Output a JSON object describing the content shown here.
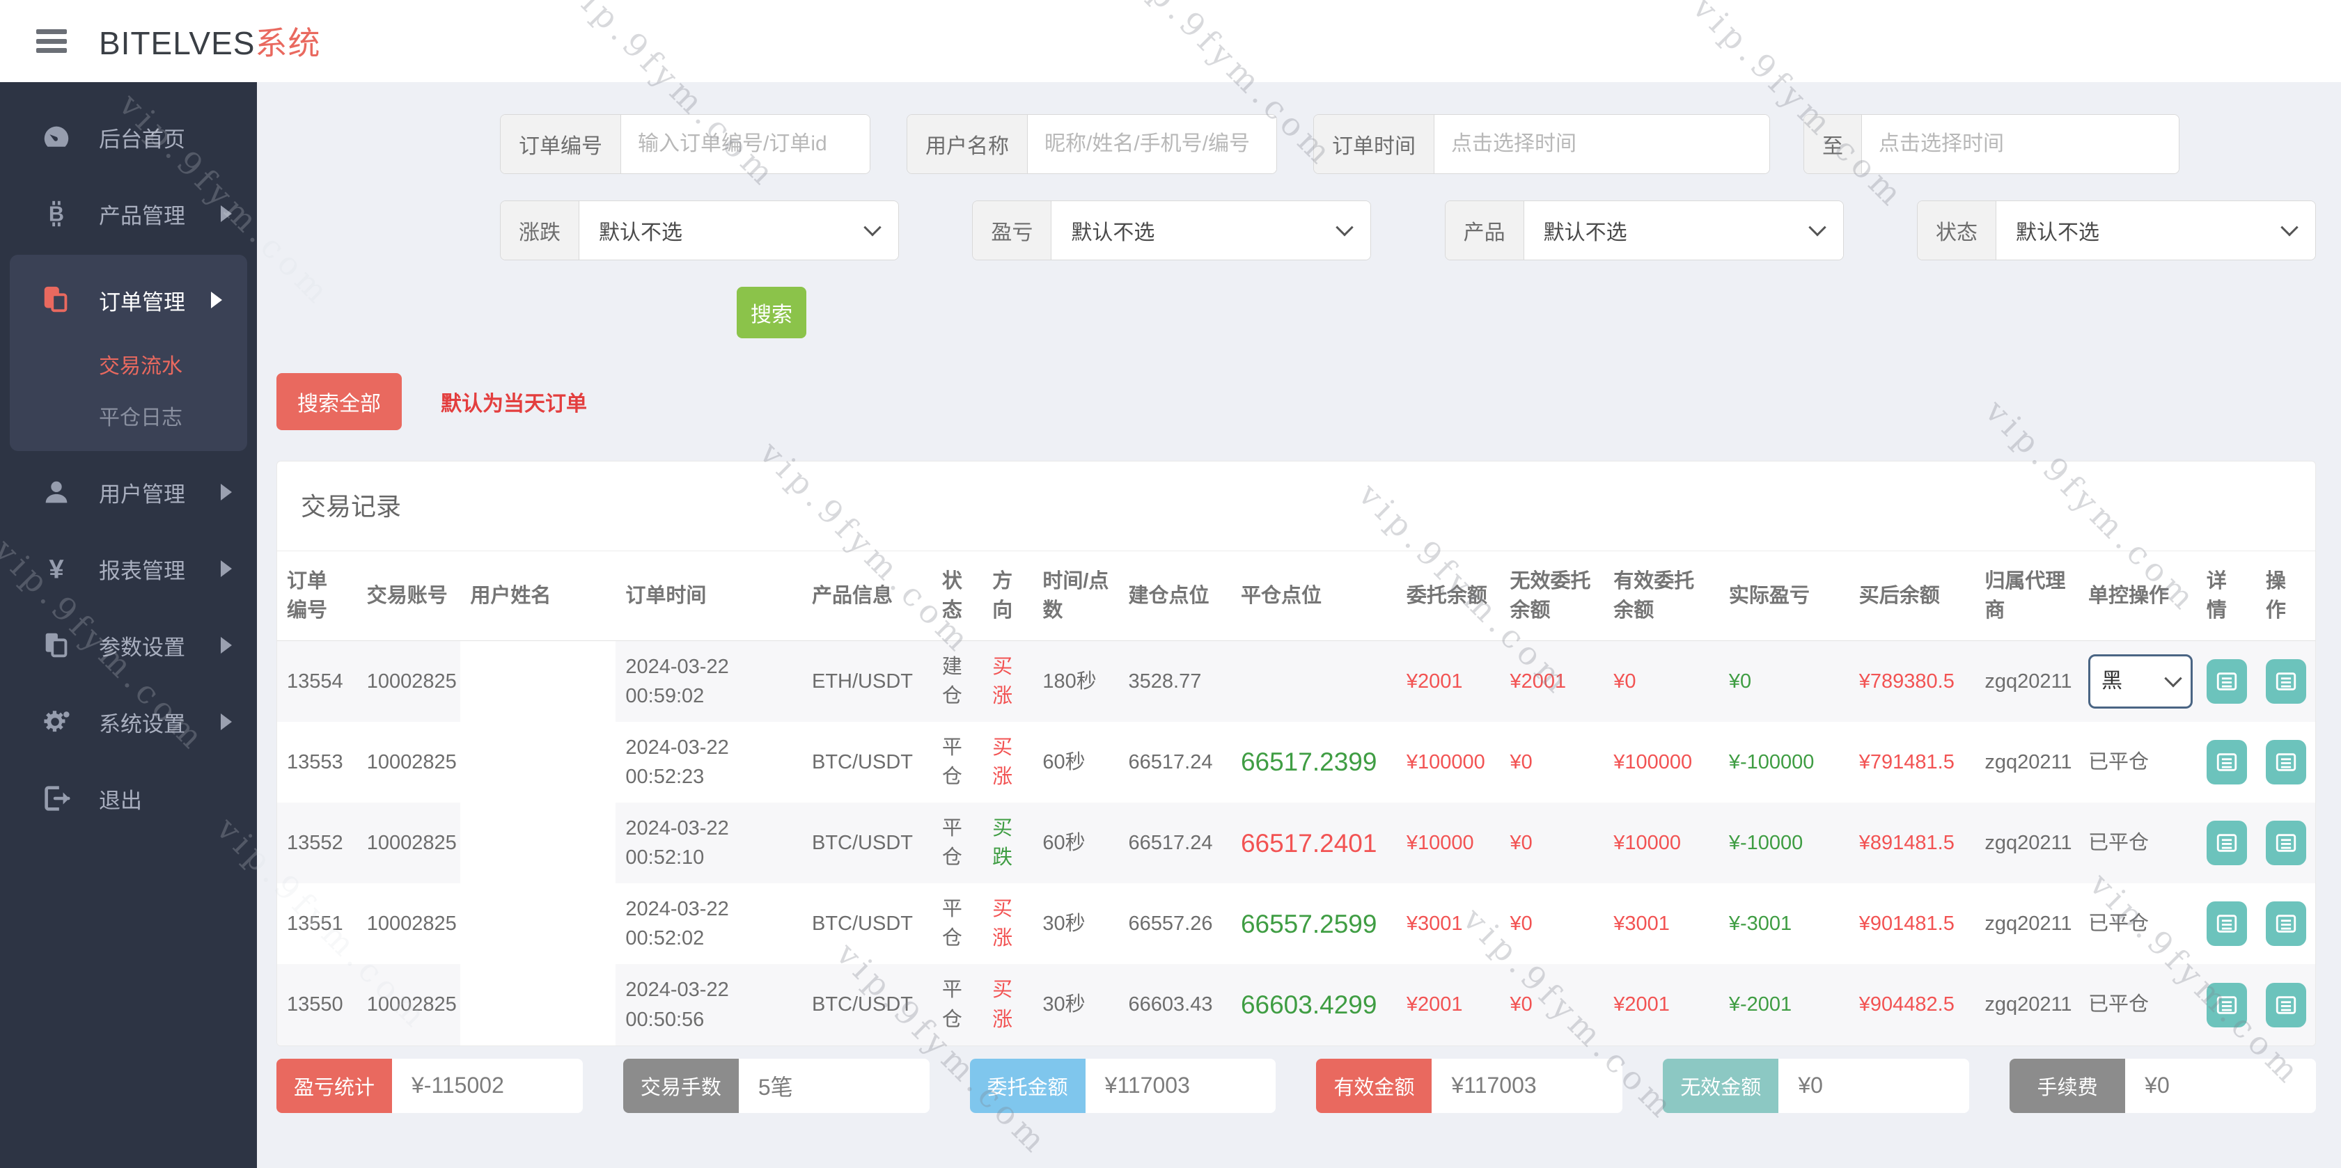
{
  "watermark": "vip.9fym.com",
  "header": {
    "brand": "BITELVES",
    "brand_suffix": "系统"
  },
  "sidebar": {
    "items": [
      {
        "label": "后台首页",
        "icon": "dashboard-icon"
      },
      {
        "label": "产品管理",
        "icon": "bitcoin-icon"
      },
      {
        "label": "订单管理",
        "icon": "orders-icon",
        "children": [
          {
            "label": "交易流水"
          },
          {
            "label": "平仓日志"
          }
        ]
      },
      {
        "label": "用户管理",
        "icon": "user-icon"
      },
      {
        "label": "报表管理",
        "icon": "yen-icon"
      },
      {
        "label": "参数设置",
        "icon": "params-icon"
      },
      {
        "label": "系统设置",
        "icon": "gear-icon"
      },
      {
        "label": "退出",
        "icon": "logout-icon"
      }
    ]
  },
  "filters": {
    "order_no_label": "订单编号",
    "order_no_placeholder": "输入订单编号/订单id",
    "user_label": "用户名称",
    "user_placeholder": "昵称/姓名/手机号/编号",
    "time_label": "订单时间",
    "time_placeholder": "点击选择时间",
    "to_label": "至",
    "time2_placeholder": "点击选择时间",
    "updown_label": "涨跌",
    "profit_label": "盈亏",
    "product_label": "产品",
    "status_label": "状态",
    "select_default": "默认不选",
    "search_btn": "搜索",
    "search_all_btn": "搜索全部",
    "hint": "默认为当天订单"
  },
  "table": {
    "title": "交易记录",
    "headers": [
      "订单编号",
      "交易账号",
      "用户姓名",
      "订单时间",
      "产品信息",
      "状态",
      "方向",
      "时间/点数",
      "建仓点位",
      "平仓点位",
      "委托余额",
      "无效委托余额",
      "有效委托余额",
      "实际盈亏",
      "买后余额",
      "归属代理商",
      "单控操作",
      "详情",
      "操作"
    ],
    "rows": [
      {
        "id": "13554",
        "account": "10002825",
        "name": "",
        "time": "2024-03-22 00:59:02",
        "product": "ETH/USDT",
        "status": "建仓",
        "dir": "买涨",
        "dur": "180秒",
        "open": "3528.77",
        "close": "",
        "entrust": "¥2001",
        "invalid": "¥2001",
        "valid": "¥0",
        "profit": "¥0",
        "after": "¥789380.5",
        "agent": "zgq20211",
        "control": "黑"
      },
      {
        "id": "13553",
        "account": "10002825",
        "name": "",
        "time": "2024-03-22 00:52:23",
        "product": "BTC/USDT",
        "status": "平仓",
        "dir": "买涨",
        "dur": "60秒",
        "open": "66517.24",
        "close": "66517.2399",
        "entrust": "¥100000",
        "invalid": "¥0",
        "valid": "¥100000",
        "profit": "¥-100000",
        "after": "¥791481.5",
        "agent": "zgq20211",
        "control": "已平仓"
      },
      {
        "id": "13552",
        "account": "10002825",
        "name": "",
        "time": "2024-03-22 00:52:10",
        "product": "BTC/USDT",
        "status": "平仓",
        "dir": "买跌",
        "dur": "60秒",
        "open": "66517.24",
        "close": "66517.2401",
        "entrust": "¥10000",
        "invalid": "¥0",
        "valid": "¥10000",
        "profit": "¥-10000",
        "after": "¥891481.5",
        "agent": "zgq20211",
        "control": "已平仓"
      },
      {
        "id": "13551",
        "account": "10002825",
        "name": "",
        "time": "2024-03-22 00:52:02",
        "product": "BTC/USDT",
        "status": "平仓",
        "dir": "买涨",
        "dur": "30秒",
        "open": "66557.26",
        "close": "66557.2599",
        "entrust": "¥3001",
        "invalid": "¥0",
        "valid": "¥3001",
        "profit": "¥-3001",
        "after": "¥901481.5",
        "agent": "zgq20211",
        "control": "已平仓"
      },
      {
        "id": "13550",
        "account": "10002825",
        "name": "",
        "time": "2024-03-22 00:50:56",
        "product": "BTC/USDT",
        "status": "平仓",
        "dir": "买涨",
        "dur": "30秒",
        "open": "66603.43",
        "close": "66603.4299",
        "entrust": "¥2001",
        "invalid": "¥0",
        "valid": "¥2001",
        "profit": "¥-2001",
        "after": "¥904482.5",
        "agent": "zgq20211",
        "control": "已平仓"
      }
    ]
  },
  "summary": {
    "items": [
      {
        "label": "盈亏统计",
        "value": "¥-115002",
        "color": "#e9695f"
      },
      {
        "label": "交易手数",
        "value": "5笔",
        "color": "#8c8c8c"
      },
      {
        "label": "委托金额",
        "value": "¥117003",
        "color": "#7fc6ed"
      },
      {
        "label": "有效金额",
        "value": "¥117003",
        "color": "#e9695f"
      },
      {
        "label": "无效金额",
        "value": "¥0",
        "color": "#8cc8c3"
      },
      {
        "label": "手续费",
        "value": "¥0",
        "color": "#8c8c8c"
      }
    ]
  },
  "colors": {
    "accent_red": "#e9695f",
    "money_red": "#f25353",
    "money_green": "#3f9d43",
    "teal_button": "#6cc3bc",
    "green_button": "#8bc34a",
    "sidebar_bg": "#2d3444",
    "main_bg": "#eef0f5"
  }
}
